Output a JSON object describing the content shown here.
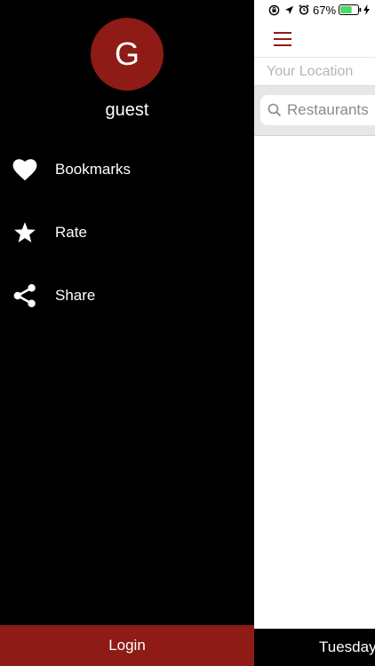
{
  "colors": {
    "accent": "#8e1b16",
    "drawer_background": "#000000",
    "battery_fill": "#4cd964"
  },
  "status_bar": {
    "battery_percent_label": "67%",
    "battery_level": 0.67,
    "icons": [
      "screen-rotation-lock-icon",
      "location-arrow-icon",
      "alarm-clock-icon",
      "battery-icon",
      "charging-bolt-icon"
    ]
  },
  "drawer": {
    "avatar_initial": "G",
    "username": "guest",
    "menu": [
      {
        "label": "Bookmarks",
        "icon": "heart-icon"
      },
      {
        "label": "Rate",
        "icon": "star-icon"
      },
      {
        "label": "Share",
        "icon": "share-icon"
      }
    ],
    "login_label": "Login"
  },
  "main": {
    "menu_icon": "hamburger-menu-icon",
    "location_placeholder": "Your Location",
    "search_placeholder": "Restaurants",
    "search_icon": "search-icon",
    "bottom_bar_text": "Tuesday"
  }
}
